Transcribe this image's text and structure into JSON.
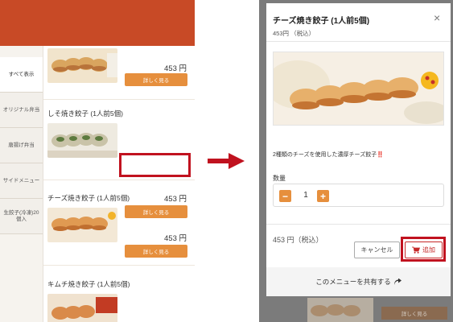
{
  "left_panel": {
    "sidebar_items": [
      {
        "label": "すべて表示",
        "active": true
      },
      {
        "label": "オリジナル弁当",
        "active": false
      },
      {
        "label": "唐揚げ弁当",
        "active": false
      },
      {
        "label": "サイドメニュー",
        "active": false
      },
      {
        "label": "生餃子(冷凍)20個入",
        "active": false
      }
    ],
    "items": [
      {
        "title": "",
        "price": "453 円",
        "button": "詳しく見る"
      },
      {
        "title": "しそ焼き餃子 (1人前5個)",
        "price": "453 円",
        "button": "詳しく見る"
      },
      {
        "title": "チーズ焼き餃子 (1人前5個)",
        "price": "453 円",
        "button": "詳しく見る"
      },
      {
        "title": "キムチ焼き餃子 (1人前5個)",
        "price": "",
        "button": ""
      }
    ]
  },
  "modal": {
    "title": "チーズ焼き餃子 (1人前5個)",
    "subtitle": "453円 （税込）",
    "close_label": "×",
    "description": "2種類のチーズを使用した濃厚チーズ餃子‼️",
    "quantity_label": "数量",
    "quantity": "1",
    "minus_label": "−",
    "plus_label": "+",
    "price_text": "453 円（税込）",
    "cancel_label": "キャンセル",
    "add_label": "追加",
    "share_label": "このメニューを共有する"
  },
  "background_button": "詳しく見る",
  "colors": {
    "header": "#c84a26",
    "accent_orange": "#e68f3d",
    "highlight_red": "#c1121f",
    "arrow_red": "#c0121f"
  },
  "icons": {
    "close": "close-icon",
    "cart": "cart-icon",
    "share": "share-arrow-icon",
    "arrow": "right-arrow-icon"
  }
}
